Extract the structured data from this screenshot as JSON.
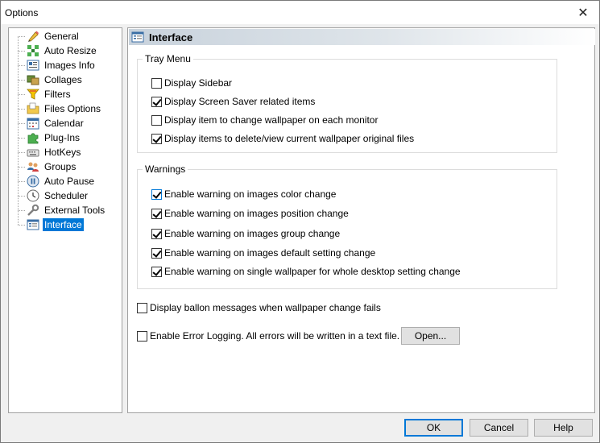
{
  "window": {
    "title": "Options",
    "close_glyph": "✕"
  },
  "nav": {
    "items": [
      {
        "label": "General",
        "icon": "pencil-icon"
      },
      {
        "label": "Auto Resize",
        "icon": "resize-icon"
      },
      {
        "label": "Images Info",
        "icon": "image-info-icon"
      },
      {
        "label": "Collages",
        "icon": "collage-icon"
      },
      {
        "label": "Filters",
        "icon": "filter-icon"
      },
      {
        "label": "Files Options",
        "icon": "files-icon"
      },
      {
        "label": "Calendar",
        "icon": "calendar-icon"
      },
      {
        "label": "Plug-Ins",
        "icon": "puzzle-icon"
      },
      {
        "label": "HotKeys",
        "icon": "keyboard-icon"
      },
      {
        "label": "Groups",
        "icon": "groups-icon"
      },
      {
        "label": "Auto Pause",
        "icon": "pause-icon"
      },
      {
        "label": "Scheduler",
        "icon": "clock-icon"
      },
      {
        "label": "External Tools",
        "icon": "wrench-icon"
      },
      {
        "label": "Interface",
        "icon": "interface-icon"
      }
    ],
    "selected": "Interface"
  },
  "panel": {
    "title": "Interface",
    "tray_menu": {
      "legend": "Tray Menu",
      "items": [
        {
          "label": "Display Sidebar",
          "checked": false
        },
        {
          "label": "Display Screen Saver related items",
          "checked": true
        },
        {
          "label": "Display item to change wallpaper on each monitor",
          "checked": false
        },
        {
          "label": "Display items to delete/view current wallpaper original files",
          "checked": true
        }
      ]
    },
    "warnings": {
      "legend": "Warnings",
      "items": [
        {
          "label": "Enable warning on images color change",
          "checked": true
        },
        {
          "label": "Enable warning on images position change",
          "checked": true
        },
        {
          "label": "Enable warning on images group change",
          "checked": true
        },
        {
          "label": "Enable warning on images default setting change",
          "checked": true
        },
        {
          "label": "Enable warning on single wallpaper for whole desktop setting change",
          "checked": true
        }
      ]
    },
    "balloon_messages": {
      "label": "Display ballon messages when wallpaper change fails",
      "checked": false
    },
    "error_logging": {
      "label": "Enable Error Logging. All errors will be written in a text file.",
      "checked": false
    },
    "open_button": "Open..."
  },
  "footer": {
    "ok": "OK",
    "cancel": "Cancel",
    "help": "Help"
  },
  "colors": {
    "selection": "#0078d7",
    "header_gradient_start": "#c8d2dc"
  }
}
